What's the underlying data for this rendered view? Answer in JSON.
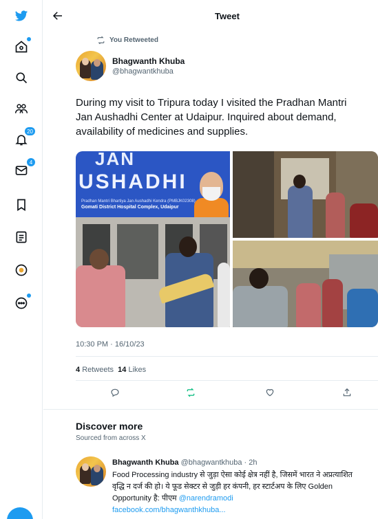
{
  "nav": {
    "items": [
      {
        "name": "x-logo",
        "icon": "bird-logo-icon"
      },
      {
        "name": "home",
        "icon": "home-icon",
        "dot": true
      },
      {
        "name": "explore",
        "icon": "search-icon"
      },
      {
        "name": "communities",
        "icon": "people-icon"
      },
      {
        "name": "notifications",
        "icon": "bell-icon",
        "badge": "20"
      },
      {
        "name": "messages",
        "icon": "mail-icon",
        "badge": "4"
      },
      {
        "name": "bookmarks",
        "icon": "bookmark-icon"
      },
      {
        "name": "lists",
        "icon": "list-icon"
      },
      {
        "name": "profile",
        "icon": "profile-icon"
      },
      {
        "name": "more",
        "icon": "more-icon",
        "dot": true
      }
    ],
    "accent": "#1d9bf0"
  },
  "header": {
    "title": "Tweet",
    "back_icon": "arrow-left-icon"
  },
  "tweet": {
    "retweet_label": "You Retweeted",
    "author_name": "Bhagwanth Khuba",
    "author_handle": "@bhagwantkhuba",
    "text_lines": [
      "During my visit to Tripura today I visited the Pradhan Mantri",
      "Jan Aushadhi Center at Udaipur. Inquired about demand,",
      "availability of medicines and supplies."
    ],
    "media": {
      "sign_line1": "JAN",
      "sign_line2": "USHADHI",
      "sign_small": "Pradhan Mantri Bhartiya Jan Aushadhi Kendra (PMBJK02308)",
      "sign_location": "Gomati District Hospital Complex, Udaipur"
    },
    "timestamp": "10:30 PM · 16/10/23",
    "retweets_count": "4",
    "retweets_label": "Retweets",
    "likes_count": "14",
    "likes_label": "Likes"
  },
  "discover": {
    "title": "Discover more",
    "subtitle": "Sourced from across X",
    "item": {
      "name": "Bhagwanth Khuba",
      "meta": "@bhagwantkhuba · 2h",
      "line1": "Food Processing industry से जुड़ा ऐसा कोई क्षेत्र नहीं है, जिसमें भारत ने अप्रत्याशित",
      "line2": "वृद्धि न दर्ज की हो। ये फूड सेक्टर से जुड़ी हर कंपनी, हर स्टार्टअप के लिए Golden",
      "line3_text": "Opportunity है: पीएम ",
      "line3_mention": "@narendramodi",
      "line4_link": "facebook.com/bhagwanthkhuba..."
    }
  }
}
